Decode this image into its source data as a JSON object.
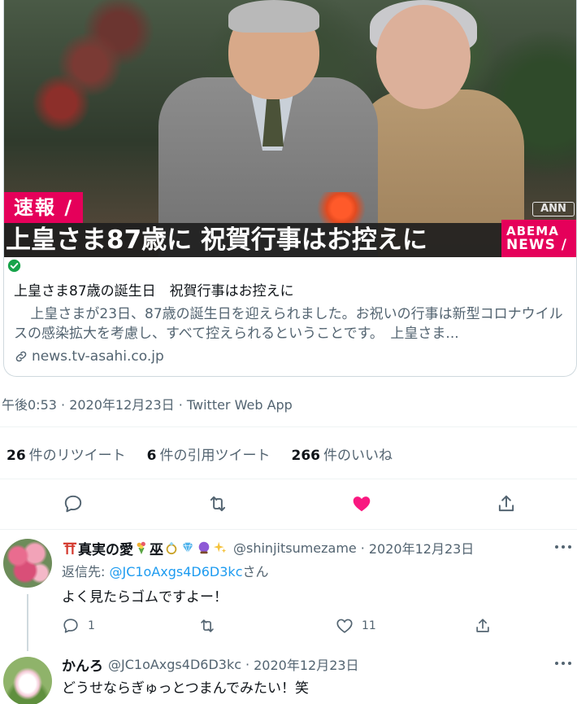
{
  "card": {
    "banner_label": "速報 /",
    "headline": "上皇さま87歳に 祝賀行事はお控えに",
    "network_logo_line1": "ABEMA",
    "network_logo_line2": "NEWS /",
    "source_logo": "ANN",
    "title": "上皇さま87歳の誕生日　祝賀行事はお控えに",
    "description": "上皇さまが23日、87歳の誕生日を迎えられました。お祝いの行事は新型コロナウイルスの感染拡大を考慮し、すべて控えられるということです。　上皇さま...",
    "domain": "news.tv-asahi.co.jp"
  },
  "tweet_meta": "午後0:53 · 2020年12月23日 · Twitter Web App",
  "stats": {
    "retweets_count": "26",
    "retweets_label": "件のリツイート",
    "quotes_count": "6",
    "quotes_label": "件の引用ツイート",
    "likes_count": "266",
    "likes_label": "件のいいね"
  },
  "colors": {
    "like_active": "#f91880",
    "icon_gray": "#536471",
    "link_blue": "#1d9bf0",
    "abema_pink": "#e5005a"
  },
  "replies": [
    {
      "display_name": "真実の愛",
      "name_suffix": "巫",
      "handle": "@shinjitsumezame",
      "date": "2020年12月23日",
      "reply_to_prefix": "返信先: ",
      "reply_to_mention": "@JC1oAxgs4D6D3kc",
      "reply_to_suffix": "さん",
      "text": "よく見たらゴムですよー！",
      "reply_count": "1",
      "like_count": "11"
    },
    {
      "display_name": "かんろ",
      "handle": "@JC1oAxgs4D6D3kc",
      "date": "2020年12月23日",
      "text": "どうせならぎゅっとつまんでみたい！笑"
    }
  ]
}
